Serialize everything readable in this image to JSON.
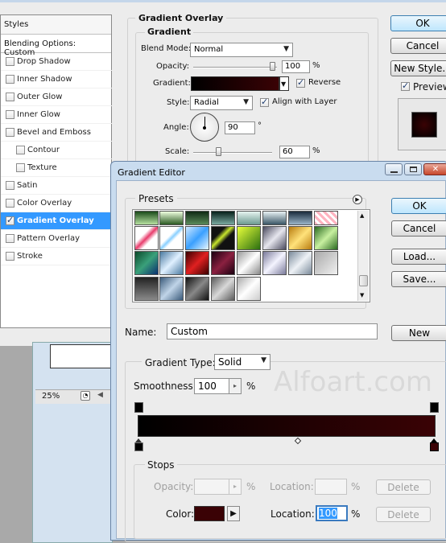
{
  "layer_style": {
    "styles_label": "Styles",
    "blending_options": "Blending Options: Custom",
    "style_items": [
      {
        "label": "Drop Shadow",
        "checked": false
      },
      {
        "label": "Inner Shadow",
        "checked": false
      },
      {
        "label": "Outer Glow",
        "checked": false
      },
      {
        "label": "Inner Glow",
        "checked": false
      },
      {
        "label": "Bevel and Emboss",
        "checked": false
      },
      {
        "label": "Contour",
        "checked": false
      },
      {
        "label": "Texture",
        "checked": false
      },
      {
        "label": "Satin",
        "checked": false
      },
      {
        "label": "Color Overlay",
        "checked": false
      },
      {
        "label": "Gradient Overlay",
        "checked": true
      },
      {
        "label": "Pattern Overlay",
        "checked": false
      },
      {
        "label": "Stroke",
        "checked": false
      }
    ],
    "section_title": "Gradient Overlay",
    "group_title": "Gradient",
    "blend_mode_label": "Blend Mode:",
    "blend_mode_value": "Normal",
    "opacity_label": "Opacity:",
    "opacity_value": "100",
    "opacity_unit": "%",
    "gradient_label": "Gradient:",
    "reverse_label": "Reverse",
    "reverse_checked": true,
    "style_label": "Style:",
    "style_value": "Radial",
    "align_label": "Align with Layer",
    "align_checked": true,
    "angle_label": "Angle:",
    "angle_value": "90",
    "angle_unit": "°",
    "scale_label": "Scale:",
    "scale_value": "60",
    "scale_unit": "%",
    "ok_label": "OK",
    "cancel_label": "Cancel",
    "new_style_label": "New Style...",
    "preview_label": "Preview",
    "preview_checked": true
  },
  "canvas": {
    "zoom": "25%"
  },
  "gradient_editor": {
    "title": "Gradient Editor",
    "presets_label": "Presets",
    "ok_label": "OK",
    "cancel_label": "Cancel",
    "load_label": "Load...",
    "save_label": "Save...",
    "name_label": "Name:",
    "name_value": "Custom",
    "new_label": "New",
    "gradient_type_label": "Gradient Type:",
    "gradient_type_value": "Solid",
    "smoothness_label": "Smoothness:",
    "smoothness_value": "100",
    "smoothness_unit": "%",
    "watermark": "Alfoart.com",
    "stops_label": "Stops",
    "opacity_label": "Opacity:",
    "opacity_unit": "%",
    "location_label": "Location:",
    "location_unit": "%",
    "delete_label": "Delete",
    "color_label": "Color:",
    "color_location_label": "Location:",
    "color_location_value": "100",
    "color_location_unit": "%",
    "delete2_label": "Delete"
  },
  "colors": {
    "gradient_start": "#000000",
    "gradient_end": "#3a0205",
    "selection": "#3399ff",
    "titlebar": "#c9dcef"
  }
}
